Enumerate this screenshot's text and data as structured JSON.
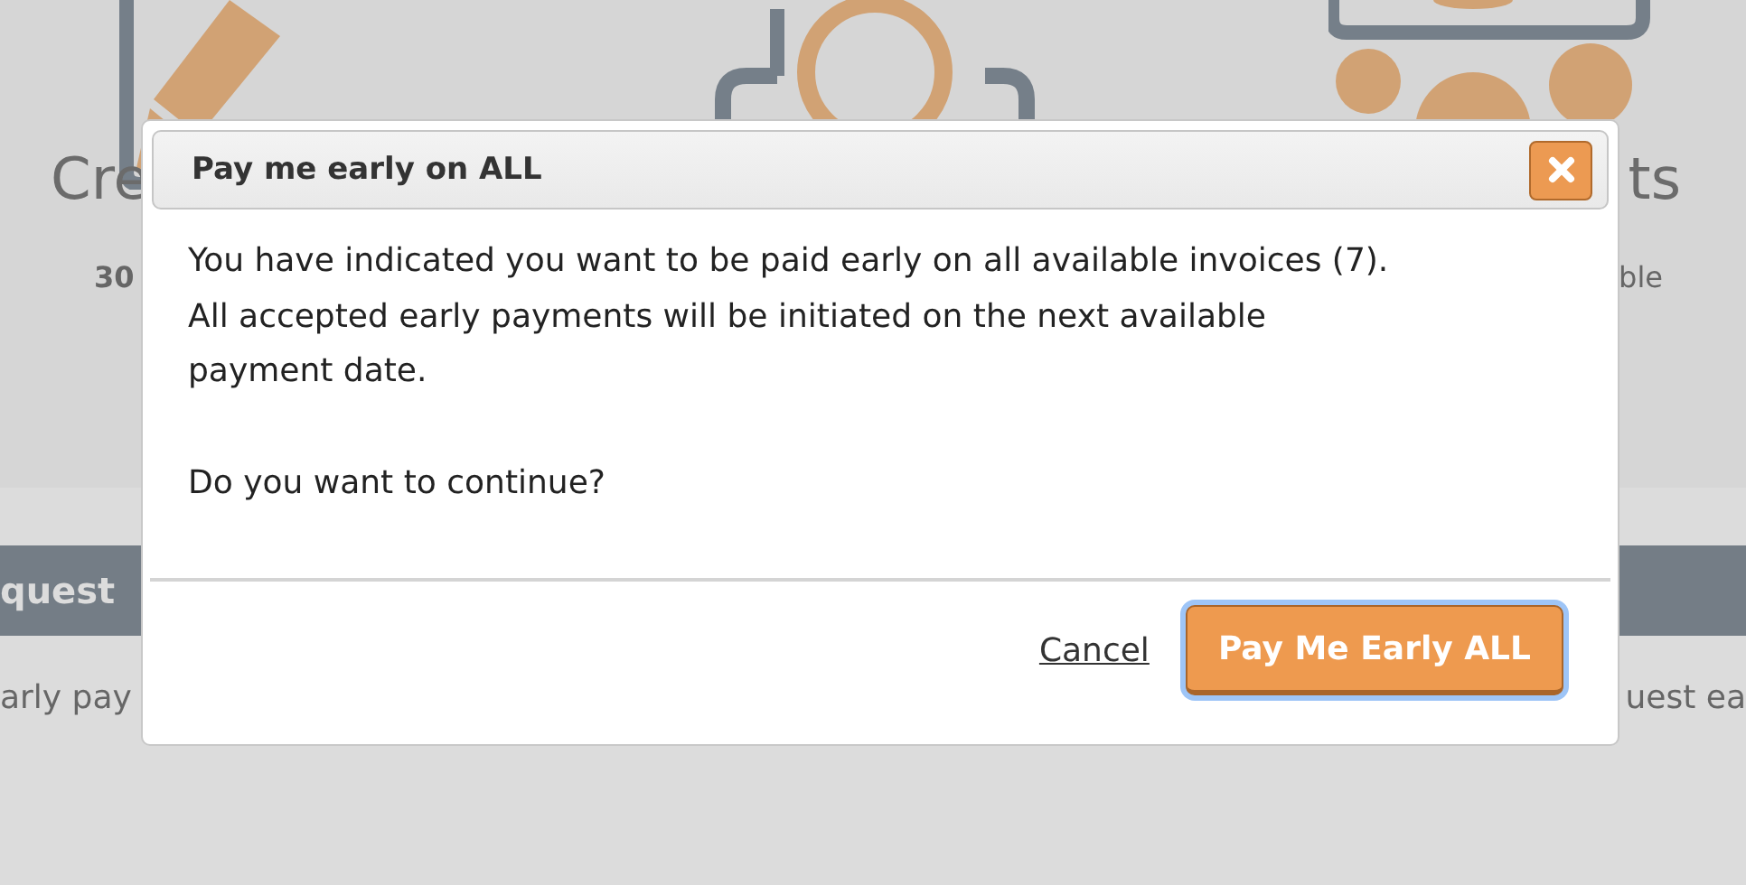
{
  "background": {
    "left_title": "Cre",
    "right_title": "ts",
    "left_stat": "30",
    "right_stat": "ble",
    "section_bar": "quest",
    "left_text": "arly pay",
    "right_text": "uest ea"
  },
  "dialog": {
    "title": "Pay me early on ALL",
    "message": "You have indicated you want to be paid early on all available invoices (7). All accepted early payments will be initiated on the next available payment date.",
    "question": "Do you want to continue?",
    "cancel": "Cancel",
    "confirm": {
      "label": "Pay Me Early ALL",
      "focused": true
    }
  }
}
